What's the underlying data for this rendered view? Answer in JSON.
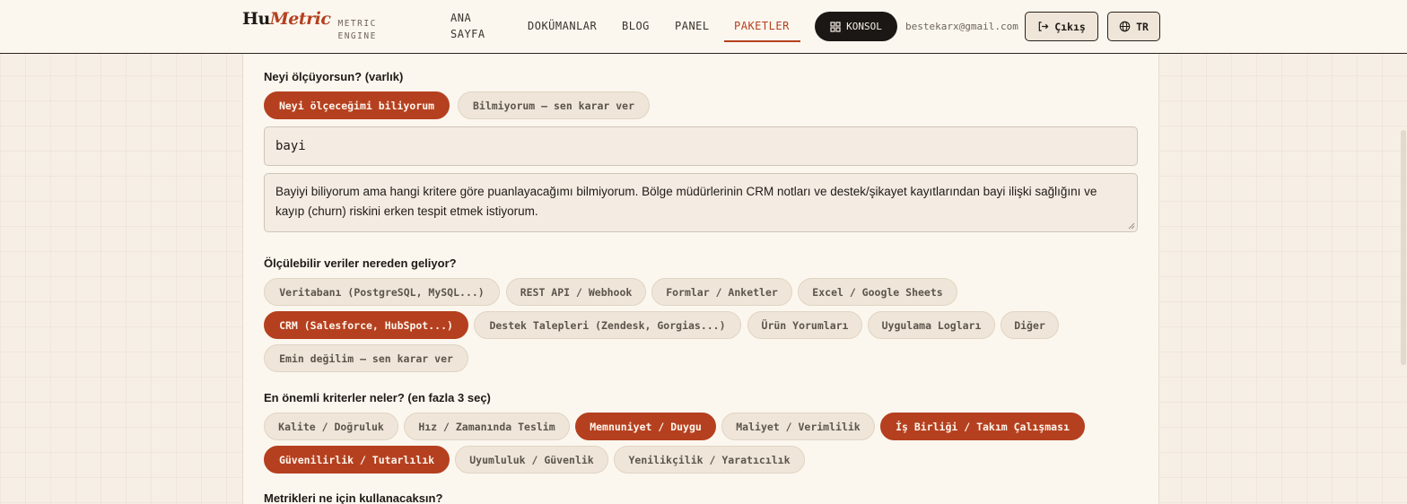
{
  "header": {
    "logo_main": "Hu",
    "logo_accent": "Metric",
    "logo_sub": "METRIC ENGINE",
    "nav": [
      {
        "label": "ANA SAYFA"
      },
      {
        "label": "DOKÜMANLAR"
      },
      {
        "label": "BLOG"
      },
      {
        "label": "PANEL"
      },
      {
        "label": "PAKETLER",
        "active": true
      }
    ],
    "konsol_label": "KONSOL",
    "email": "bestekarx@gmail.com",
    "logout_label": "Çıkış",
    "lang_label": "TR"
  },
  "form": {
    "entity": {
      "label": "Neyi ölçüyorsun? (varlık)",
      "options": [
        {
          "label": "Neyi ölçeceğimi biliyorum",
          "selected": true
        },
        {
          "label": "Bilmiyorum — sen karar ver",
          "selected": false
        }
      ],
      "input_value": "bayi",
      "description": "Bayiyi biliyorum ama hangi kritere göre puanlayacağımı bilmiyorum. Bölge müdürlerinin CRM notları ve destek/şikayet kayıtlarından bayi ilişki sağlığını ve kayıp (churn) riskini erken tespit etmek istiyorum."
    },
    "sources": {
      "label": "Ölçülebilir veriler nereden geliyor?",
      "options": [
        {
          "label": "Veritabanı (PostgreSQL, MySQL...)",
          "selected": false
        },
        {
          "label": "REST API / Webhook",
          "selected": false
        },
        {
          "label": "Formlar / Anketler",
          "selected": false
        },
        {
          "label": "Excel / Google Sheets",
          "selected": false
        },
        {
          "label": "CRM (Salesforce, HubSpot...)",
          "selected": true
        },
        {
          "label": "Destek Talepleri (Zendesk, Gorgias...)",
          "selected": false
        },
        {
          "label": "Ürün Yorumları",
          "selected": false
        },
        {
          "label": "Uygulama Logları",
          "selected": false
        },
        {
          "label": "Diğer",
          "selected": false
        },
        {
          "label": "Emin değilim — sen karar ver",
          "selected": false
        }
      ]
    },
    "criteria": {
      "label": "En önemli kriterler neler? (en fazla 3 seç)",
      "options": [
        {
          "label": "Kalite / Doğruluk",
          "selected": false
        },
        {
          "label": "Hız / Zamanında Teslim",
          "selected": false
        },
        {
          "label": "Memnuniyet / Duygu",
          "selected": true
        },
        {
          "label": "Maliyet / Verimlilik",
          "selected": false
        },
        {
          "label": "İş Birliği / Takım Çalışması",
          "selected": true
        },
        {
          "label": "Güvenilirlik / Tutarlılık",
          "selected": true
        },
        {
          "label": "Uyumluluk / Güvenlik",
          "selected": false
        },
        {
          "label": "Yenilikçilik / Yaratıcılık",
          "selected": false
        }
      ]
    },
    "usage": {
      "label": "Metrikleri ne için kullanacaksın?"
    }
  },
  "colors": {
    "accent": "#b5401f",
    "background": "#f6efe6",
    "dark": "#1b1714"
  }
}
